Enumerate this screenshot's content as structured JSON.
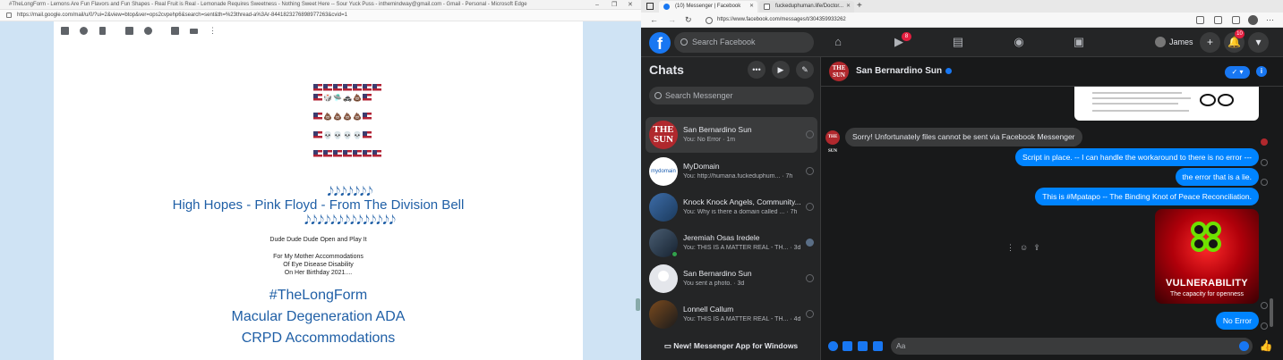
{
  "left_window": {
    "title_bar": "#TheLongForm - Lemons Are Fun Flavors and Fun Shapes - Real Fruit is Real - Lemonade Requires Sweetness - Nothing Sweet Here -- Sour Yuck Puss - inthemindway@gmail.com - Gmail - Personal - Microsoft Edge",
    "url": "https://mail.google.com/mail/u/0/?ui=2&view=btop&ver=ops2cvpehp6&search=sent&th=%23thread-a%3Ar-8441823276898977263&cvid=1",
    "window_controls": [
      "–",
      "❐",
      "✕"
    ],
    "toolbar_icons": [
      "archive-icon",
      "report-icon",
      "delete-icon",
      "mark-unread-icon",
      "snooze-icon",
      "add-task-icon",
      "label-icon",
      "more-icon"
    ],
    "email": {
      "emoji_rows": [
        [
          "flag",
          "flag",
          "flag",
          "flag",
          "flag",
          "flag",
          "flag"
        ],
        [
          "flag",
          "🎲",
          "🛸",
          "🚓",
          "💩",
          "flag"
        ],
        [
          "flag",
          "💩",
          "💩",
          "💩",
          "💩",
          "flag"
        ],
        [
          "flag",
          "💀",
          "💀",
          "💀",
          "💀",
          "flag"
        ],
        [
          "flag",
          "flag",
          "flag",
          "flag",
          "flag",
          "flag",
          "flag"
        ]
      ],
      "notes_top": "𝅘𝅥𝅮𝅘𝅥𝅮𝅘𝅥𝅮𝅘𝅥𝅮𝅘𝅥𝅮𝅘𝅥𝅮𝅘𝅥𝅮",
      "song_title": "High Hopes - Pink Floyd - From The Division Bell",
      "notes_bottom": "𝅘𝅥𝅮𝅘𝅥𝅮𝅘𝅥𝅮𝅘𝅥𝅮𝅘𝅥𝅮𝅘𝅥𝅮𝅘𝅥𝅮𝅘𝅥𝅮𝅘𝅥𝅮𝅘𝅥𝅮𝅘𝅥𝅮𝅘𝅥𝅮𝅘𝅥𝅮𝅘𝅥𝅮",
      "line_dude": "Dude Dude Dude Open and Play It",
      "mother_lines": [
        "For My Mother Accommodations",
        "Of Eye Disease Disability",
        "On Her Birthday 2021...."
      ],
      "hashtag": "#TheLongForm",
      "heading_macular": "Macular Degeneration ADA",
      "heading_crpd": "CRPD Accommodations"
    }
  },
  "right_window": {
    "tabs": [
      {
        "label": "(10) Messenger | Facebook",
        "icon": "messenger-favicon"
      },
      {
        "label": "fuckeduphuman.life/Doctor...",
        "icon": "page-favicon"
      }
    ],
    "new_tab": "+",
    "nav": {
      "back": "←",
      "forward": "→",
      "refresh": "↻"
    },
    "url": "https://www.facebook.com/messages/t/304359933262",
    "facebook": {
      "logo": "f",
      "search_placeholder": "Search Facebook",
      "watch_badge": "8",
      "notifications_badge": "10",
      "user_name": "James",
      "plus": "+",
      "dropdown": "▾"
    },
    "chats": {
      "title": "Chats",
      "buttons": {
        "options": "•••",
        "video": "▶",
        "compose": "✎"
      },
      "search_placeholder": "Search Messenger",
      "list": [
        {
          "name": "San Bernardino Sun",
          "snippet": "You: No Error · 1m",
          "avatar": "THE SUN",
          "active": true
        },
        {
          "name": "MyDomain",
          "snippet": "You: http://humana.fuckeduphum... · 7h",
          "avatar": "mydomain"
        },
        {
          "name": "Knock Knock Angels, Community...",
          "snippet": "You: Why is there a domain called ... · 7h",
          "avatar": ""
        },
        {
          "name": "Jeremiah Osas Iredele",
          "snippet": "You: THIS IS A MATTER REAL - TH... · 3d",
          "avatar": ""
        },
        {
          "name": "San Bernardino Sun",
          "snippet": "You sent a photo. · 3d",
          "avatar": ""
        },
        {
          "name": "Lonnell Callum",
          "snippet": "You: THIS IS A MATTER REAL - TH... · 4d",
          "avatar": ""
        }
      ],
      "new_app": "New! Messenger App for Windows"
    },
    "conversation": {
      "name": "San Bernardino Sun",
      "header_avatar": "THE SUN",
      "call_label": "✓ ▾",
      "info_label": "i",
      "incoming_message": "Sorry! Unfortunately files cannot be sent via Facebook Messenger",
      "outgoing_messages": [
        "Script in place.  -- I can handle the workaround to there is no error ---",
        "the error that is a lie.",
        "This is #Mpatapo -- The Binding Knot of Peace Reconciliation."
      ],
      "poster": {
        "title": "VULNERABILITY",
        "subtitle": "The capacity for openness"
      },
      "last_message": "No Error",
      "composer_placeholder": "Aa",
      "like": "👍"
    }
  }
}
